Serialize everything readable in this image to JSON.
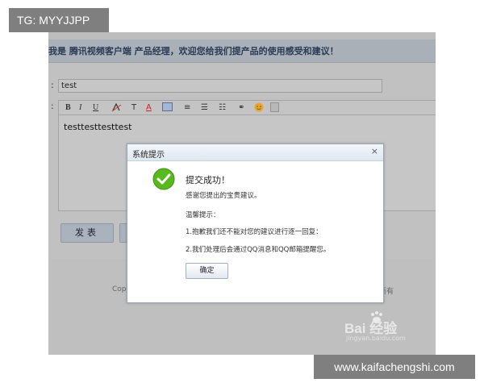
{
  "tag_top": "TG: MYYJJPP",
  "tag_bottom": "www.kaifachengshi.com",
  "header": {
    "text": "我是 腾讯视频客户端 产品经理，欢迎您给我们提产品的使用感受和建议！"
  },
  "form": {
    "colon": ":",
    "title_value": "test",
    "editor_value": "testtesttesttest",
    "toolbar": {
      "bold": "B",
      "italic": "I",
      "underline": "U",
      "font_size": "T",
      "text_color": "A",
      "align": "≡",
      "list": "☰",
      "list2": "☷",
      "link": "⚭",
      "emoji": "☺",
      "image": "▣"
    },
    "post_button": "发表"
  },
  "footer": {
    "left_text": "Cop",
    "right_text": "所有"
  },
  "watermark": {
    "brand": "Bai  经验",
    "url": "jingyan.baidu.com"
  },
  "dialog": {
    "title": "系统提示",
    "close": "×",
    "success_title": "提交成功！",
    "thanks": "感谢您提出的宝贵建议。",
    "tip_title": "温馨提示：",
    "tip1": "1.抱歉我们还不能对您的建议进行逐一回复：",
    "tip2": "2.我们处理后会通过QQ消息和QQ邮箱提醒您。",
    "ok": "确定"
  },
  "colors": {
    "success_green": "#58b91e",
    "header_blue": "#2b3a55"
  }
}
